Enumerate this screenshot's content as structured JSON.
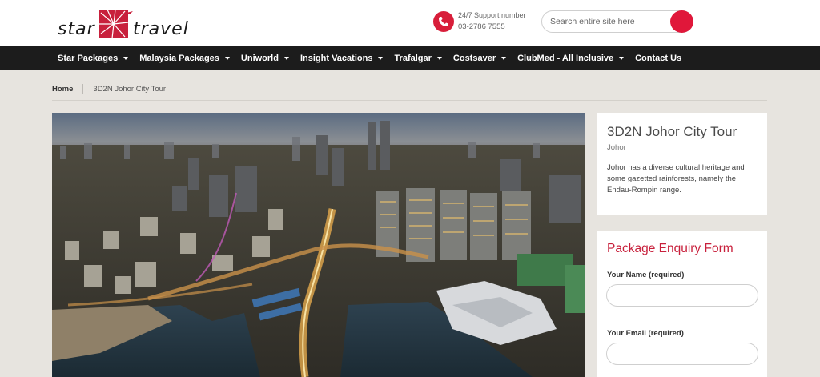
{
  "header": {
    "logo": {
      "word1": "star",
      "word2": "travel"
    },
    "support": {
      "label": "24/7 Support number",
      "number": "03-2786 7555"
    },
    "search": {
      "placeholder": "Search entire site here"
    }
  },
  "nav": {
    "items": [
      {
        "label": "Star Packages",
        "dropdown": true
      },
      {
        "label": "Malaysia Packages",
        "dropdown": true
      },
      {
        "label": "Uniworld",
        "dropdown": true
      },
      {
        "label": "Insight Vacations",
        "dropdown": true
      },
      {
        "label": "Trafalgar",
        "dropdown": true
      },
      {
        "label": "Costsaver",
        "dropdown": true
      },
      {
        "label": "ClubMed - All Inclusive",
        "dropdown": true
      },
      {
        "label": "Contact Us",
        "dropdown": false
      }
    ]
  },
  "breadcrumb": {
    "home": "Home",
    "current": "3D2N Johor City Tour"
  },
  "tour": {
    "title": "3D2N Johor City Tour",
    "location": "Johor",
    "description": "Johor has a diverse cultural heritage and some gazetted rainforests, namely the Endau-Rompin range."
  },
  "enquiry_form": {
    "title": "Package Enquiry Form",
    "name_label": "Your Name (required)",
    "email_label": "Your Email (required)"
  },
  "colors": {
    "accent": "#e0173a",
    "nav_bg": "#1c1c1c",
    "page_bg": "#e7e4df",
    "form_title": "#c8203c"
  },
  "icons": [
    "phone-icon",
    "search-icon",
    "chevron-down-icon",
    "logo-star-mark"
  ]
}
